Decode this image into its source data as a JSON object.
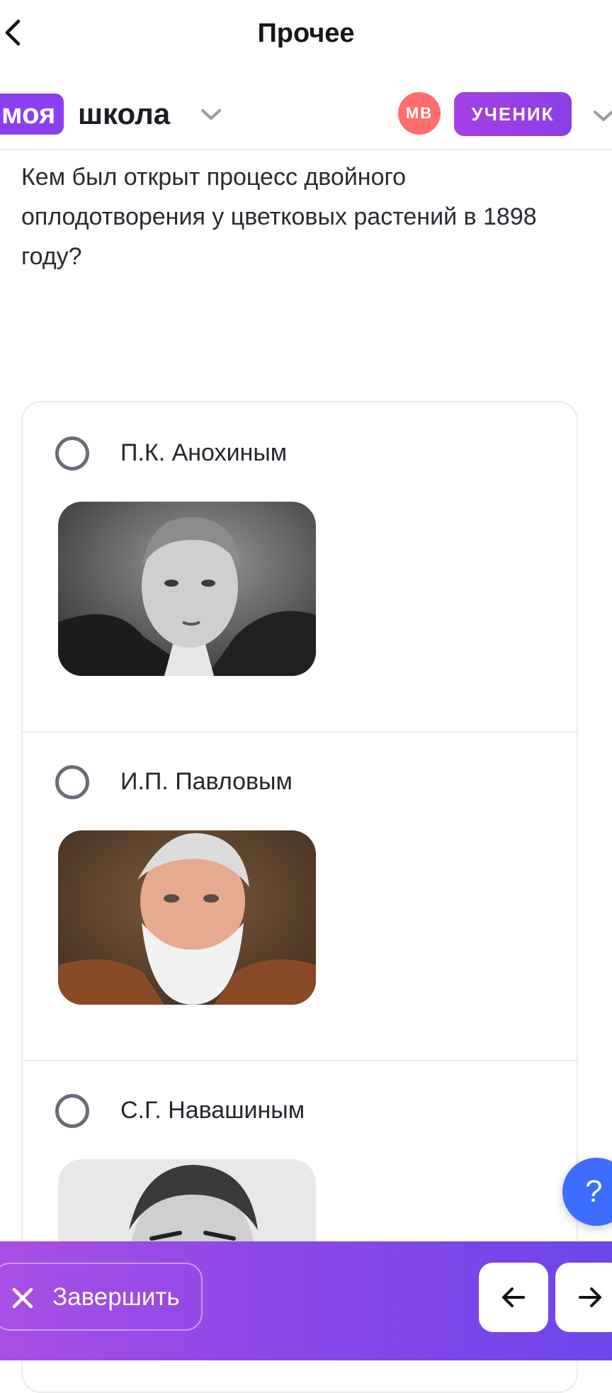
{
  "header": {
    "title": "Прочее",
    "back_icon": "chevron-left-icon"
  },
  "brand": {
    "logo_highlight": "моя",
    "logo_word": "школа",
    "avatar_initials": "МВ",
    "role_label": "УЧЕНИК",
    "colors": {
      "accent": "#8b3ff0",
      "avatar": "#ff6d6d",
      "help": "#3d6dff"
    }
  },
  "question": {
    "text": "Кем был открыт процесс двойного оплодотворения у цветковых растений в 1898 году?"
  },
  "options": [
    {
      "label": "П.К. Анохиным",
      "selected": false,
      "image": "black-and-white portrait photo"
    },
    {
      "label": "И.П. Павловым",
      "selected": false,
      "image": "painted portrait with white beard"
    },
    {
      "label": "С.Г. Навашиным",
      "selected": false,
      "image": "black-and-white portrait photo"
    }
  ],
  "help_button": {
    "label": "?"
  },
  "footer": {
    "finish_label": "Завершить",
    "prev_icon": "arrow-left-icon",
    "next_icon": "arrow-right-icon"
  }
}
